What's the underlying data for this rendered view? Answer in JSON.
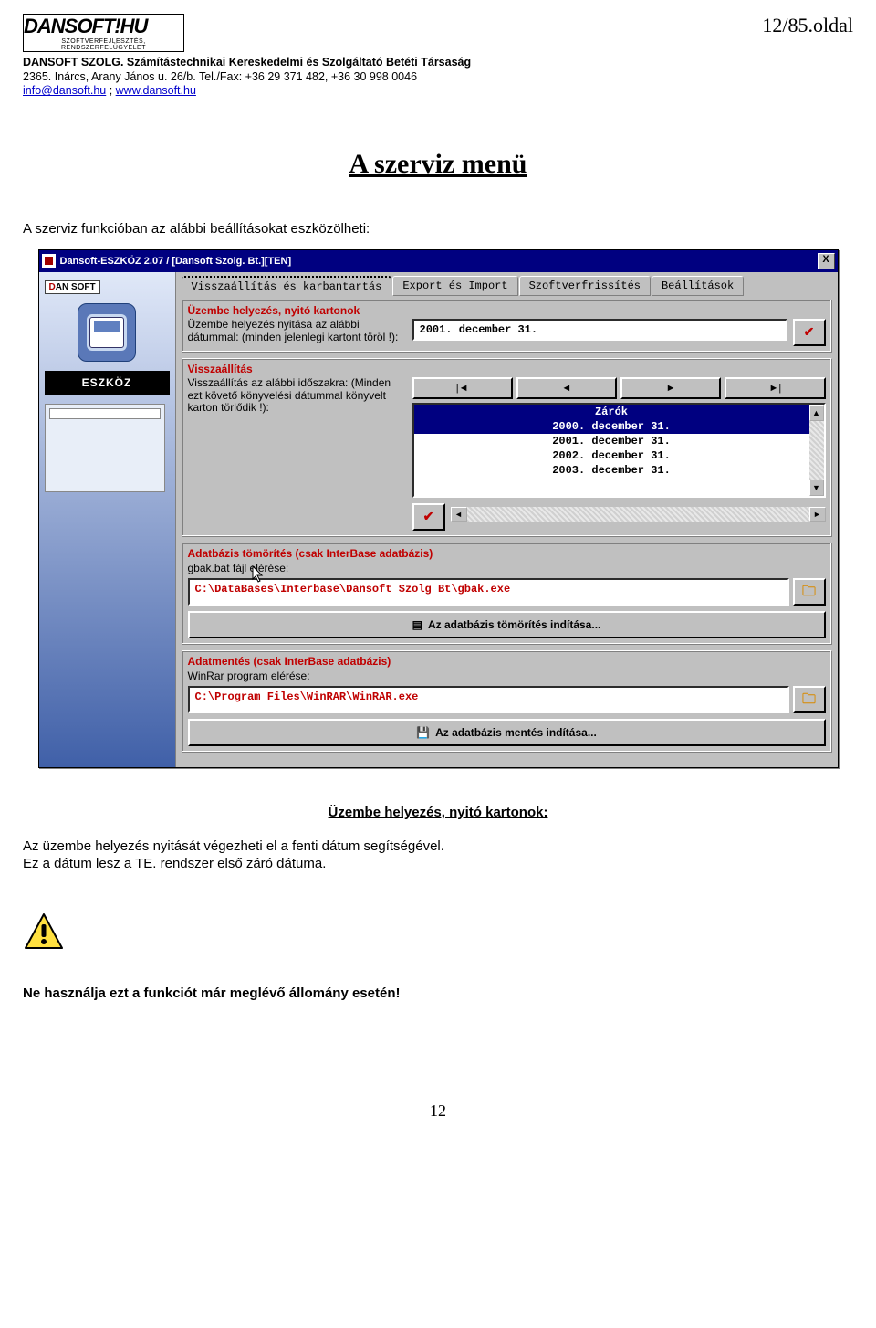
{
  "header": {
    "logo_main": "DANSOFT!HU",
    "logo_sub": "SZOFTVERFEJLESZTÉS, RENDSZERFELÜGYELET",
    "company": "DANSOFT SZOLG. Számítástechnikai Kereskedelmi és Szolgáltató Betéti Társaság",
    "address": "2365. Inárcs, Arany János u. 26/b. Tel./Fax: +36 29 371 482, +36 30 998 0046",
    "email": "info@dansoft.hu",
    "sep": " ; ",
    "web": "www.dansoft.hu",
    "page_indicator": "12/85.oldal"
  },
  "title": "A szerviz menü",
  "intro": "A szerviz funkcióban az alábbi beállításokat eszközölheti:",
  "window": {
    "title": "Dansoft-ESZKÖZ 2.07 / [Dansoft Szolg. Bt.][TEN]",
    "close": "X",
    "panel_brand": "DAN SOFT",
    "panel_label": "ESZKÖZ",
    "tabs": [
      "Visszaállítás és karbantartás",
      "Export és Import",
      "Szoftverfrissítés",
      "Beállítások"
    ],
    "g1_title": "Üzembe helyezés, nyitó kartonok",
    "g1_desc": "Üzembe helyezés nyitása az alábbi dátummal: (minden jelenlegi kartont töröl !):",
    "g1_date": "2001. december 31.",
    "g2_title": "Visszaállítás",
    "g2_desc": "Visszaállítás az alábbi időszakra: (Minden ezt követő könyvelési dátummal könyvelt karton törlődik !):",
    "nav": {
      "first": "|◄",
      "prev": "◄",
      "next": "►",
      "last": "►|"
    },
    "list_header": "Zárók",
    "list_items": [
      "2000. december 31.",
      "2001. december 31.",
      "2002. december 31.",
      "2003. december 31."
    ],
    "g3_title": "Adatbázis tömörítés (csak InterBase adatbázis)",
    "g3_label": "gbak.bat fájl elérése:",
    "g3_path": "C:\\DataBases\\Interbase\\Dansoft Szolg Bt\\gbak.exe",
    "g3_button": "Az adatbázis tömörítés indítása...",
    "g4_title": "Adatmentés (csak InterBase adatbázis)",
    "g4_label": "WinRar program elérése:",
    "g4_path": "C:\\Program Files\\WinRAR\\WinRAR.exe",
    "g4_button": "Az adatbázis mentés indítása..."
  },
  "sub_title": "Üzembe helyezés, nyitó kartonok:",
  "para1": "Az üzembe helyezés nyitását végezheti el a fenti dátum segítségével.",
  "para2": "Ez a dátum lesz a TE. rendszer első záró dátuma.",
  "warn": "Ne használja ezt a funkciót már meglévő állomány esetén!",
  "page_number": "12"
}
